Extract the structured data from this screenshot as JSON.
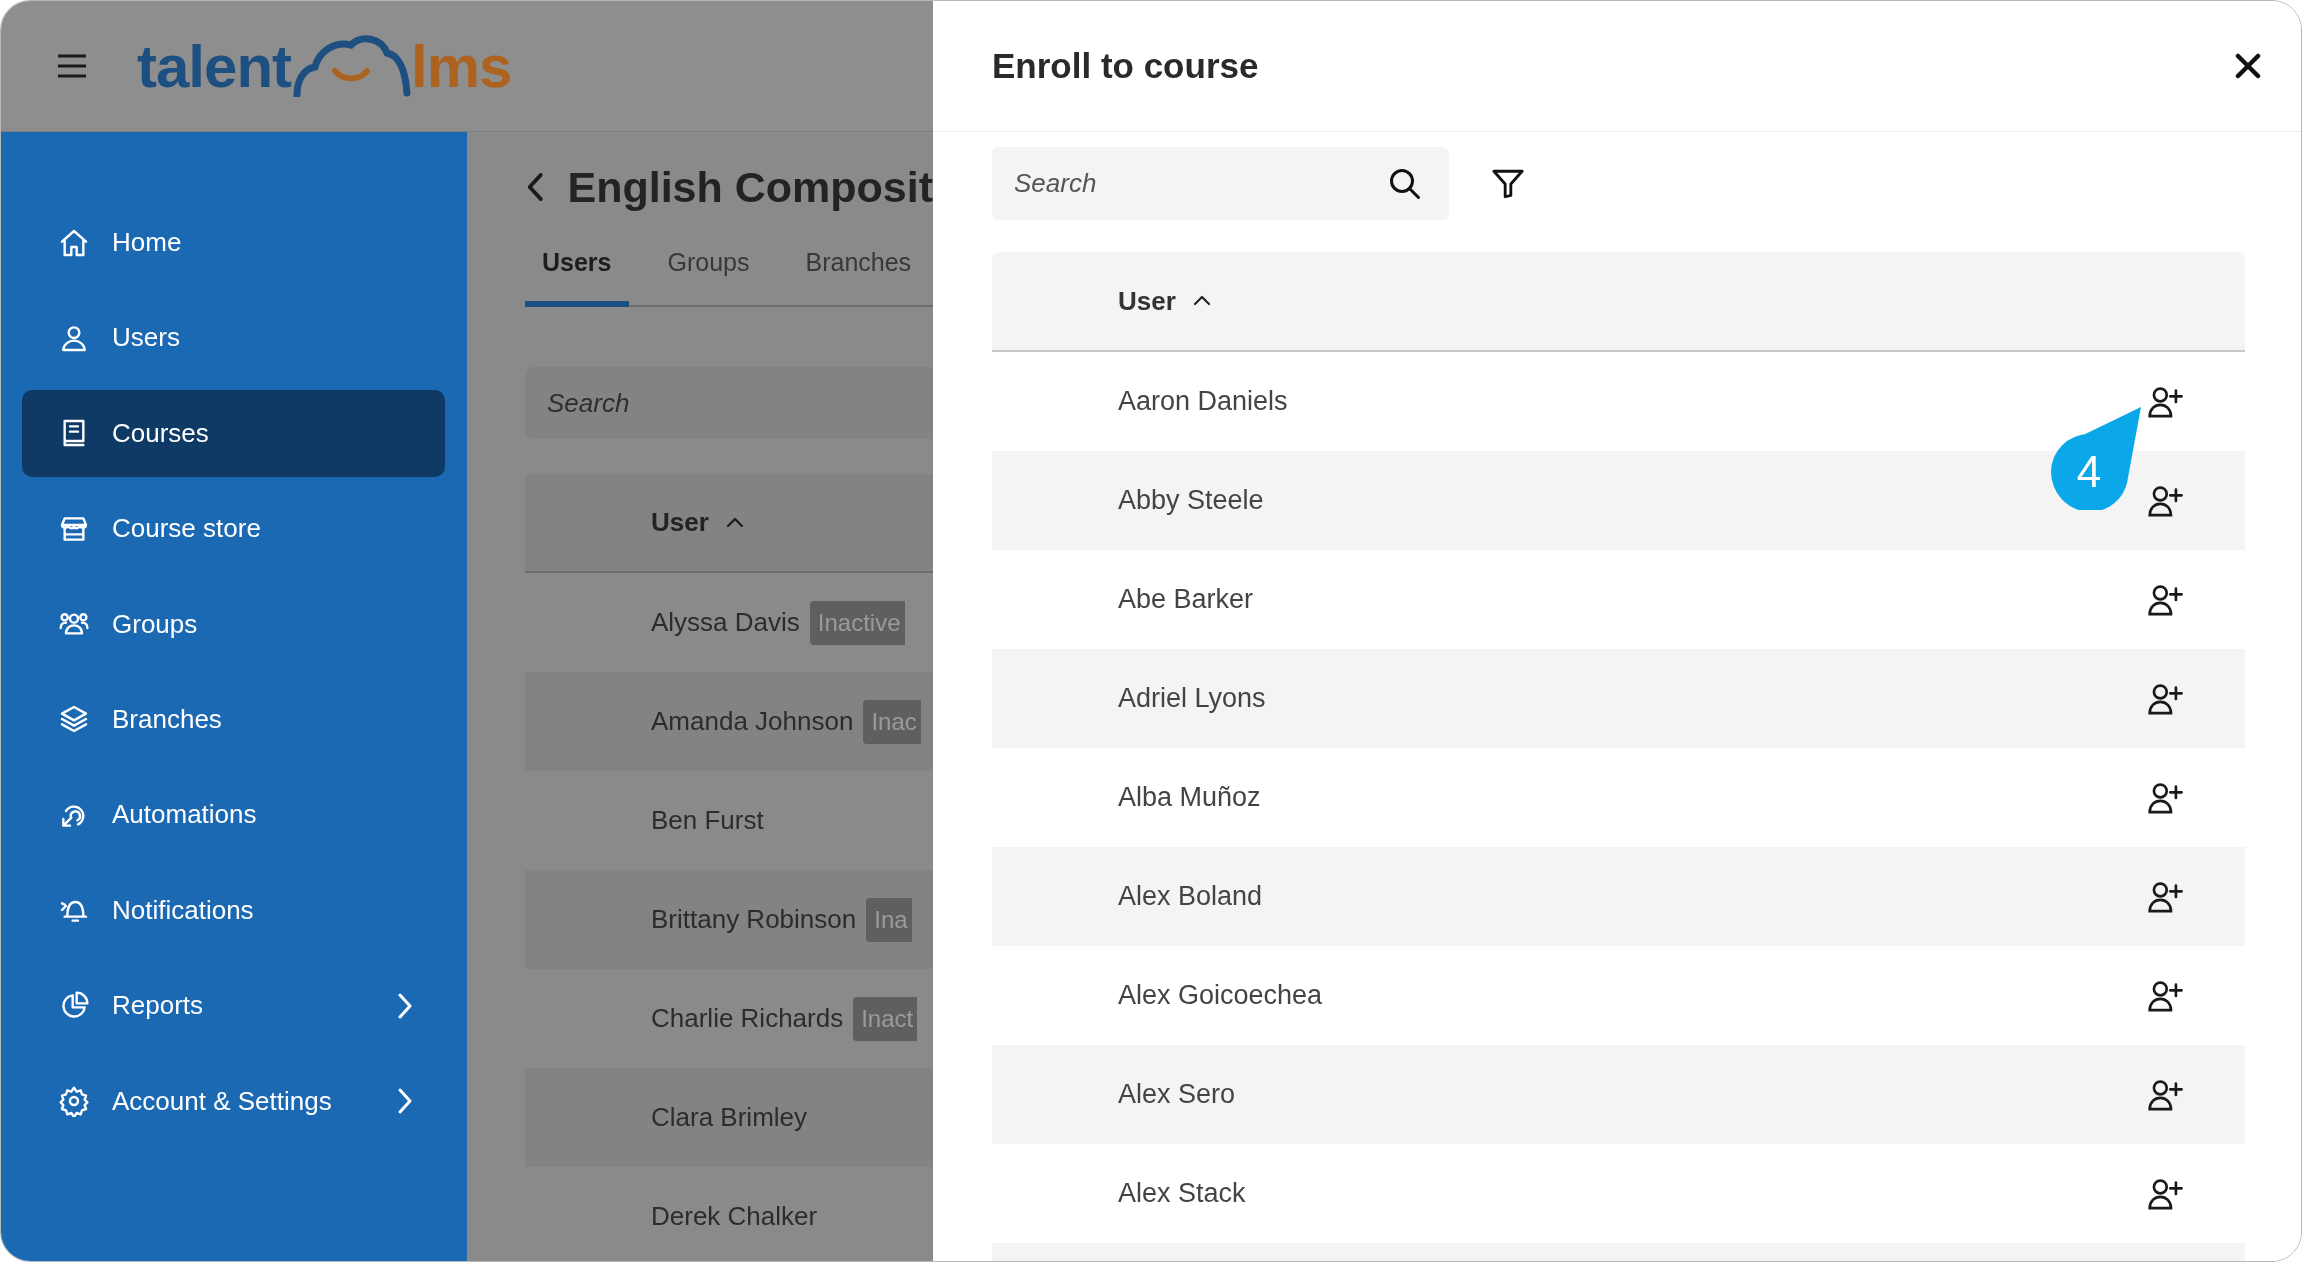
{
  "header": {
    "logo": {
      "part_1": "talent",
      "part_2": "lms"
    }
  },
  "sidebar": {
    "items": [
      {
        "label": "Home",
        "selected": false,
        "expandable": false
      },
      {
        "label": "Users",
        "selected": false,
        "expandable": false
      },
      {
        "label": "Courses",
        "selected": true,
        "expandable": false
      },
      {
        "label": "Course store",
        "selected": false,
        "expandable": false
      },
      {
        "label": "Groups",
        "selected": false,
        "expandable": false
      },
      {
        "label": "Branches",
        "selected": false,
        "expandable": false
      },
      {
        "label": "Automations",
        "selected": false,
        "expandable": false
      },
      {
        "label": "Notifications",
        "selected": false,
        "expandable": false
      },
      {
        "label": "Reports",
        "selected": false,
        "expandable": true
      },
      {
        "label": "Account & Settings",
        "selected": false,
        "expandable": true
      }
    ]
  },
  "course_page": {
    "title": "English Composit",
    "tabs": [
      {
        "label": "Users",
        "selected": true
      },
      {
        "label": "Groups",
        "selected": false
      },
      {
        "label": "Branches",
        "selected": false
      }
    ],
    "search": {
      "placeholder": "Search"
    },
    "table": {
      "columns": [
        {
          "label": "User",
          "sort_ascending": true
        }
      ],
      "rows": [
        {
          "user": "Alyssa Davis",
          "status": "Inactive"
        },
        {
          "user": "Amanda Johnson",
          "status": "Inac"
        },
        {
          "user": "Ben Furst"
        },
        {
          "user": "Brittany Robinson",
          "status": "Ina"
        },
        {
          "user": "Charlie Richards",
          "status": "Inact"
        },
        {
          "user": "Clara Brimley"
        },
        {
          "user": "Derek Chalker"
        }
      ]
    }
  },
  "dialog": {
    "title": "Enroll to course",
    "search": {
      "placeholder": "Search"
    },
    "table": {
      "columns": [
        {
          "label": "User",
          "sort_ascending": true
        }
      ],
      "rows": [
        {
          "user": "Aaron Daniels"
        },
        {
          "user": "Abby Steele"
        },
        {
          "user": "Abe Barker"
        },
        {
          "user": "Adriel Lyons"
        },
        {
          "user": "Alba Muñoz"
        },
        {
          "user": "Alex Boland"
        },
        {
          "user": "Alex Goicoechea"
        },
        {
          "user": "Alex Sero"
        },
        {
          "user": "Alex Stack"
        }
      ]
    }
  },
  "callout": {
    "label": "4"
  }
}
